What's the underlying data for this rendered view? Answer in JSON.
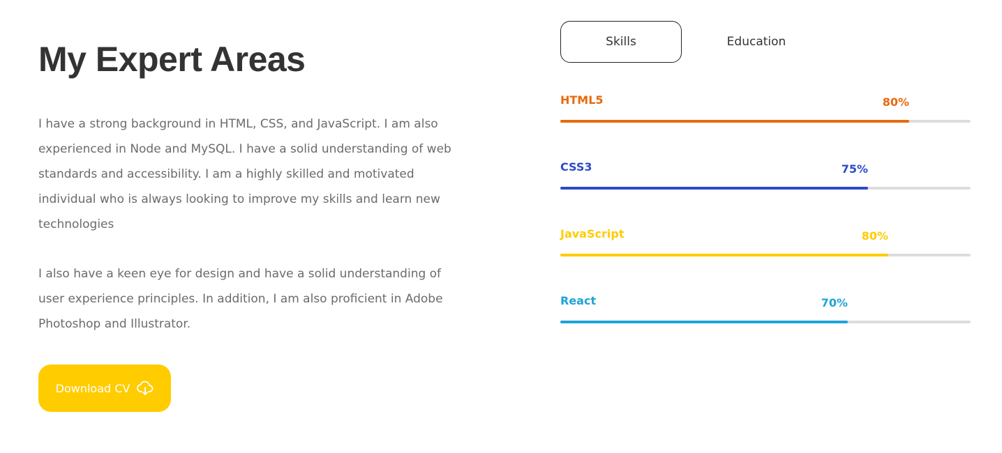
{
  "about": {
    "title": "My Expert Areas",
    "paragraph_1": "I have a strong background in HTML, CSS, and JavaScript. I am also experienced in Node and MySQL. I have a solid understanding of web standards and accessibility. I am a highly skilled and motivated individual who is always looking to improve my skills and learn new technologies",
    "paragraph_2": "I also have a keen eye for design and have a solid understanding of user experience principles. In addition, I am also proficient in Adobe Photoshop and Illustrator.",
    "download_button": {
      "label": "Download CV",
      "icon": "cloud-download-icon",
      "color": "#ffcc00"
    }
  },
  "tabs": [
    {
      "label": "Skills",
      "active": true
    },
    {
      "label": "Education",
      "active": false
    }
  ],
  "skills": [
    {
      "name": "HTML5",
      "percent_label": "80%",
      "fill_fraction": 0.85,
      "color": "#e8690a"
    },
    {
      "name": "CSS3",
      "percent_label": "75%",
      "fill_fraction": 0.75,
      "color": "#2a4bcc"
    },
    {
      "name": "JavaScript",
      "percent_label": "80%",
      "fill_fraction": 0.8,
      "color": "#ffcc00"
    },
    {
      "name": "React",
      "percent_label": "70%",
      "fill_fraction": 0.7,
      "color": "#1fa3d8"
    }
  ]
}
